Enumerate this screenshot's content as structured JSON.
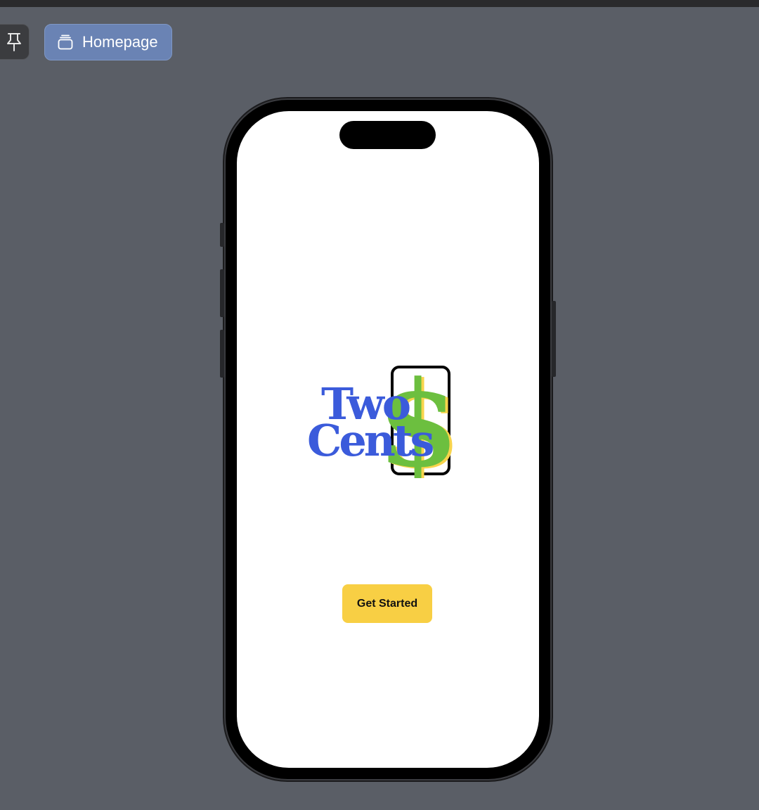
{
  "toolbar": {
    "pin_icon": "pin-icon",
    "tab": {
      "label": "Homepage",
      "icon": "stack-icon"
    }
  },
  "app": {
    "logo": {
      "line1": "Two",
      "line2": "Cents",
      "symbol": "$",
      "colors": {
        "text": "#3b5bdb",
        "dollar": "#6cbf3f",
        "dollar_shadow": "#f8d44c",
        "frame": "#000000"
      }
    },
    "cta_label": "Get Started",
    "cta_color": "#f8cf44"
  },
  "colors": {
    "background": "#5a5e66",
    "tab_active": "#6a83b4"
  }
}
